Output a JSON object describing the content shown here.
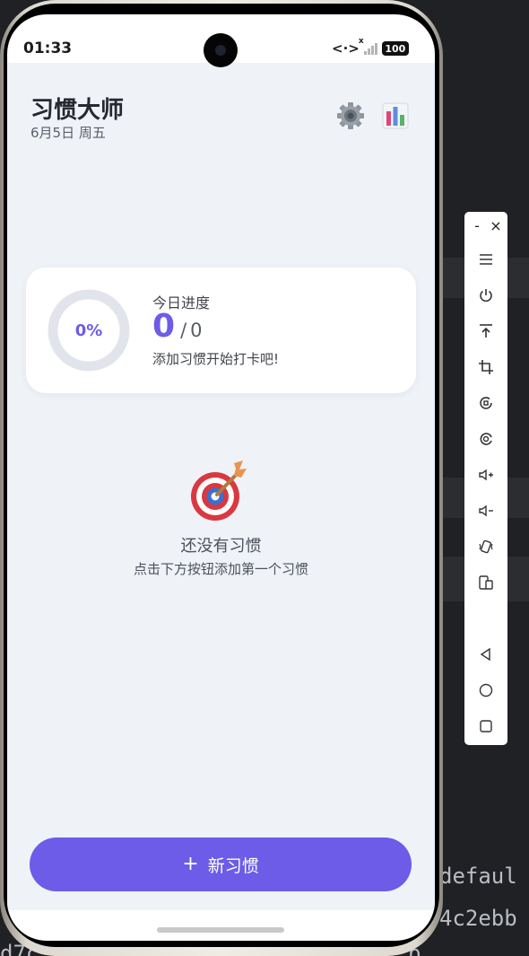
{
  "background": {
    "code_lines": [
      "defaul",
      "4c2ebb",
      "d7c",
      "b"
    ]
  },
  "status_bar": {
    "time": "01:33",
    "network_glyph": "<·>",
    "no_signal_mark": "x",
    "battery": "100"
  },
  "header": {
    "title": "习惯大师",
    "date": "6月5日 周五",
    "settings_icon": "gear-icon",
    "stats_icon": "bar-chart-icon"
  },
  "progress_card": {
    "percent_text": "0%",
    "percent_value": 0,
    "label": "今日进度",
    "done": "0",
    "separator": "/",
    "total": "0",
    "hint": "添加习惯开始打卡吧!"
  },
  "empty_state": {
    "icon": "target-icon",
    "title": "还没有习惯",
    "subtitle": "点击下方按钮添加第一个习惯"
  },
  "new_button": {
    "plus": "+",
    "label": "新习惯"
  },
  "toolbar": {
    "minimize": "-",
    "close": "×",
    "buttons": [
      "menu-icon",
      "power-icon",
      "pin-top-icon",
      "crop-icon",
      "rotate-icon",
      "screenshot-icon",
      "volume-up-icon",
      "volume-down-icon",
      "shake-icon",
      "devices-icon",
      "back-icon",
      "home-icon",
      "recents-icon"
    ]
  },
  "colors": {
    "accent": "#6c5ce7",
    "app_background": "#eff2f7",
    "ring_track": "#e1e5eb"
  }
}
